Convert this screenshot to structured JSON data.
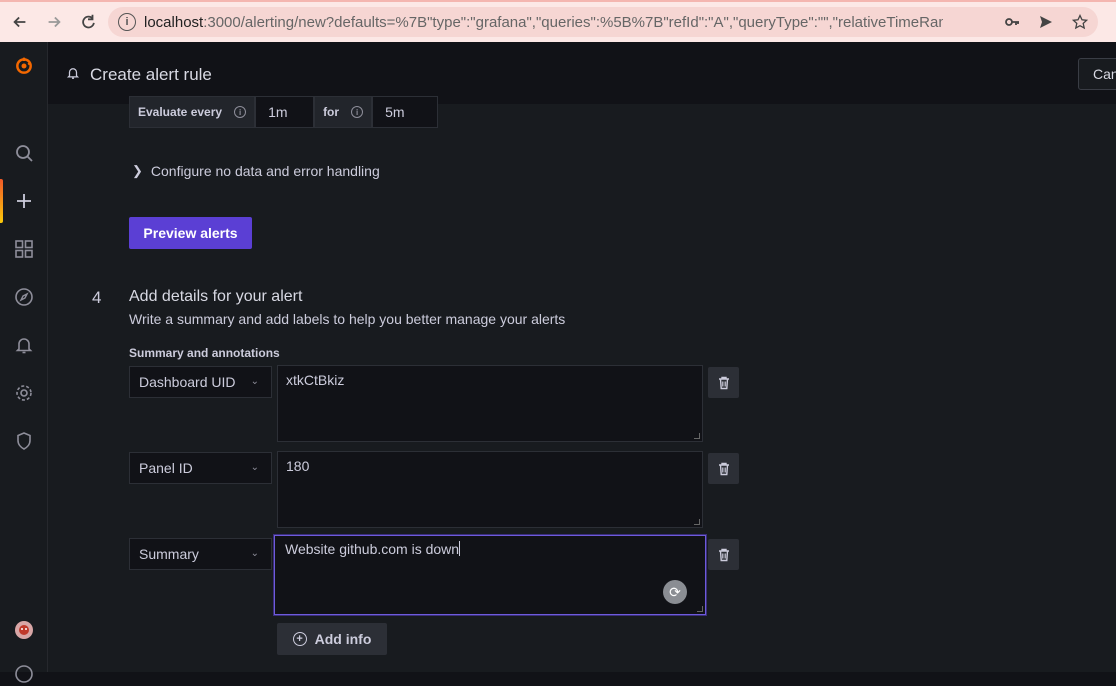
{
  "browser": {
    "url_host": "localhost",
    "url_path": ":3000/alerting/new?defaults=%7B\"type\":\"grafana\",\"queries\":%5B%7B\"refId\":\"A\",\"queryType\":\"\",\"relativeTimeRange\":%7B\"..."
  },
  "header": {
    "title": "Create alert rule",
    "cancel_label": "Can"
  },
  "evaluation": {
    "every_label": "Evaluate every",
    "every_value": "1m",
    "for_label": "for",
    "for_value": "5m"
  },
  "config_toggle_label": "Configure no data and error handling",
  "preview_button_label": "Preview alerts",
  "step": {
    "number": "4",
    "title": "Add details for your alert",
    "description": "Write a summary and add labels to help you better manage your alerts"
  },
  "annotations": {
    "label": "Summary and annotations",
    "rows": [
      {
        "key": "Dashboard UID",
        "value": "xtkCtBkiz"
      },
      {
        "key": "Panel ID",
        "value": "180"
      },
      {
        "key": "Summary",
        "value": "Website github.com is down"
      }
    ],
    "add_label": "Add info"
  },
  "colors": {
    "primary_button": "#5b3fd4",
    "focus_border": "#6e5bdb",
    "background": "#181b1f"
  }
}
